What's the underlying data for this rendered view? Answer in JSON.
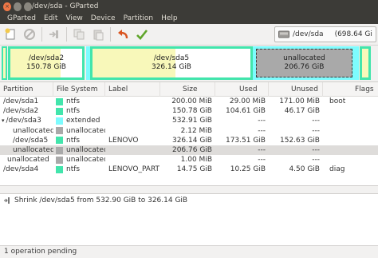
{
  "window": {
    "title": "/dev/sda - GParted"
  },
  "menu": [
    "GParted",
    "Edit",
    "View",
    "Device",
    "Partition",
    "Help"
  ],
  "device": {
    "name": "/dev/sda",
    "size": "(698.64 Gi"
  },
  "diskmap": {
    "segments": [
      {
        "name": "/dev/sda2",
        "size": "150.78 GiB"
      },
      {
        "name": "/dev/sda5",
        "size": "326.14 GiB"
      },
      {
        "name": "unallocated",
        "size": "206.76 GiB"
      }
    ]
  },
  "table": {
    "headers": [
      "Partition",
      "File System",
      "Label",
      "Size",
      "Used",
      "Unused",
      "Flags"
    ],
    "rows": [
      {
        "partition": "/dev/sda1",
        "fs": "ntfs",
        "label": "",
        "size": "200.00 MiB",
        "used": "29.00 MiB",
        "unused": "171.00 MiB",
        "flags": "boot"
      },
      {
        "partition": "/dev/sda2",
        "fs": "ntfs",
        "label": "",
        "size": "150.78 GiB",
        "used": "104.61 GiB",
        "unused": "46.17 GiB",
        "flags": ""
      },
      {
        "partition": "/dev/sda3",
        "fs": "extended",
        "label": "",
        "size": "532.91 GiB",
        "used": "---",
        "unused": "---",
        "flags": ""
      },
      {
        "partition": "unallocated",
        "fs": "unallocated",
        "label": "",
        "size": "2.12 MiB",
        "used": "---",
        "unused": "---",
        "flags": ""
      },
      {
        "partition": "/dev/sda5",
        "fs": "ntfs",
        "label": "LENOVO",
        "size": "326.14 GiB",
        "used": "173.51 GiB",
        "unused": "152.63 GiB",
        "flags": ""
      },
      {
        "partition": "unallocated",
        "fs": "unallocated",
        "label": "",
        "size": "206.76 GiB",
        "used": "---",
        "unused": "---",
        "flags": ""
      },
      {
        "partition": "unallocated",
        "fs": "unallocated",
        "label": "",
        "size": "1.00 MiB",
        "used": "---",
        "unused": "---",
        "flags": ""
      },
      {
        "partition": "/dev/sda4",
        "fs": "ntfs",
        "label": "LENOVO_PART",
        "size": "14.75 GiB",
        "used": "10.25 GiB",
        "unused": "4.50 GiB",
        "flags": "diag"
      }
    ]
  },
  "operations": [
    "Shrink /dev/sda5 from 532.90 GiB to 326.14 GiB"
  ],
  "status": "1 operation pending",
  "colors": {
    "ntfs": "#42e5ac",
    "extended": "#7dfcfe",
    "unallocated": "#a9a9a9",
    "used_fill": "#f8f8ba",
    "ntfs_border": "#42e5ac",
    "extended_border": "#7dfcfe"
  }
}
